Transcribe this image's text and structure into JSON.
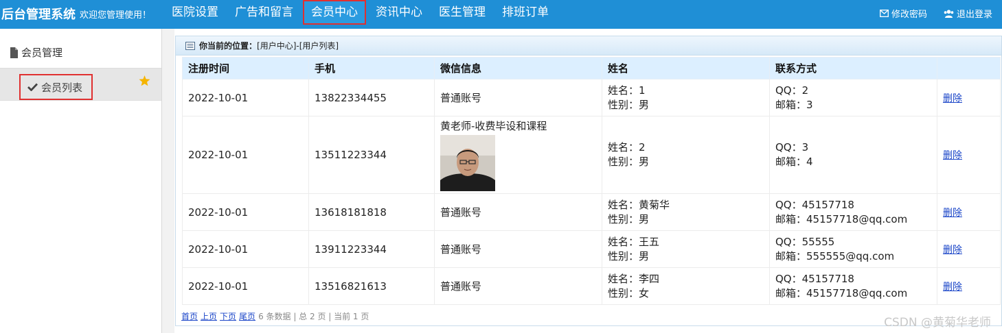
{
  "header": {
    "brand": "后台管理系统",
    "welcome": "欢迎您管理使用！",
    "nav": [
      {
        "label": "医院设置",
        "active": false
      },
      {
        "label": "广告和留言",
        "active": false
      },
      {
        "label": "会员中心",
        "active": true
      },
      {
        "label": "资讯中心",
        "active": false
      },
      {
        "label": "医生管理",
        "active": false
      },
      {
        "label": "排班订单",
        "active": false
      }
    ],
    "change_password": "修改密码",
    "logout": "退出登录"
  },
  "sidebar": {
    "group": "会员管理",
    "item": "会员列表"
  },
  "breadcrumb": {
    "label": "你当前的位置：",
    "path": "[用户中心]-[用户列表]"
  },
  "table": {
    "columns": [
      "注册时间",
      "手机",
      "微信信息",
      "姓名",
      "联系方式",
      ""
    ],
    "rows": [
      {
        "date": "2022-10-01",
        "phone": "13822334455",
        "wechat": "普通账号",
        "name": "姓名：1",
        "gender": "性别：男",
        "qq": "QQ：2",
        "email": "邮箱：3",
        "action": "删除",
        "has_avatar": false
      },
      {
        "date": "2022-10-01",
        "phone": "13511223344",
        "wechat": "黄老师-收费毕设和课程",
        "name": "姓名：2",
        "gender": "性别：男",
        "qq": "QQ：3",
        "email": "邮箱：4",
        "action": "删除",
        "has_avatar": true
      },
      {
        "date": "2022-10-01",
        "phone": "13618181818",
        "wechat": "普通账号",
        "name": "姓名：黄菊华",
        "gender": "性别：男",
        "qq": "QQ：45157718",
        "email": "邮箱：45157718@qq.com",
        "action": "删除",
        "has_avatar": false
      },
      {
        "date": "2022-10-01",
        "phone": "13911223344",
        "wechat": "普通账号",
        "name": "姓名：王五",
        "gender": "性别：男",
        "qq": "QQ：55555",
        "email": "邮箱：555555@qq.com",
        "action": "删除",
        "has_avatar": false
      },
      {
        "date": "2022-10-01",
        "phone": "13516821613",
        "wechat": "普通账号",
        "name": "姓名：李四",
        "gender": "性别：女",
        "qq": "QQ：45157718",
        "email": "邮箱：45157718@qq.com",
        "action": "删除",
        "has_avatar": false
      }
    ]
  },
  "pager": {
    "first": "首页",
    "prev": "上页",
    "next": "下页",
    "last": "尾页",
    "summary": "6 条数据 | 总 2 页 | 当前 1 页"
  },
  "watermark": "CSDN @黄菊华老师",
  "colors": {
    "topbar": "#1f8fd6",
    "highlight": "#e03030",
    "header_row": "#dcefff",
    "link": "#1a45c8",
    "star": "#f5b400"
  }
}
